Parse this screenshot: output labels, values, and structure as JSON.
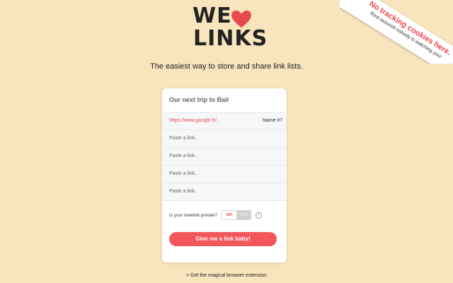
{
  "logo": {
    "we": "WE",
    "links": "LINKS"
  },
  "tagline": "The easiest way to store and share link lists.",
  "ribbon": {
    "line1": "No tracking cookies here.",
    "line2": "Rest assured nobody is watching you!"
  },
  "card": {
    "title": "Our next trip to Bali",
    "links": [
      {
        "value": "https://www.google.fr/..",
        "name_label": "Name it?"
      },
      {
        "placeholder": "Paste a link.."
      },
      {
        "placeholder": "Paste a link.."
      },
      {
        "placeholder": "Paste a link.."
      },
      {
        "placeholder": "Paste a link.."
      }
    ],
    "private_label": "Is your lovelink private?",
    "toggle": {
      "no": "NO",
      "yes": "YES",
      "selected": "NO"
    },
    "submit_label": "Give me a link baby!"
  },
  "extension_link": "> Get the magical browser extension",
  "colors": {
    "background": "#f8e4bd",
    "accent": "#e8494e",
    "button": "#f2575b"
  }
}
